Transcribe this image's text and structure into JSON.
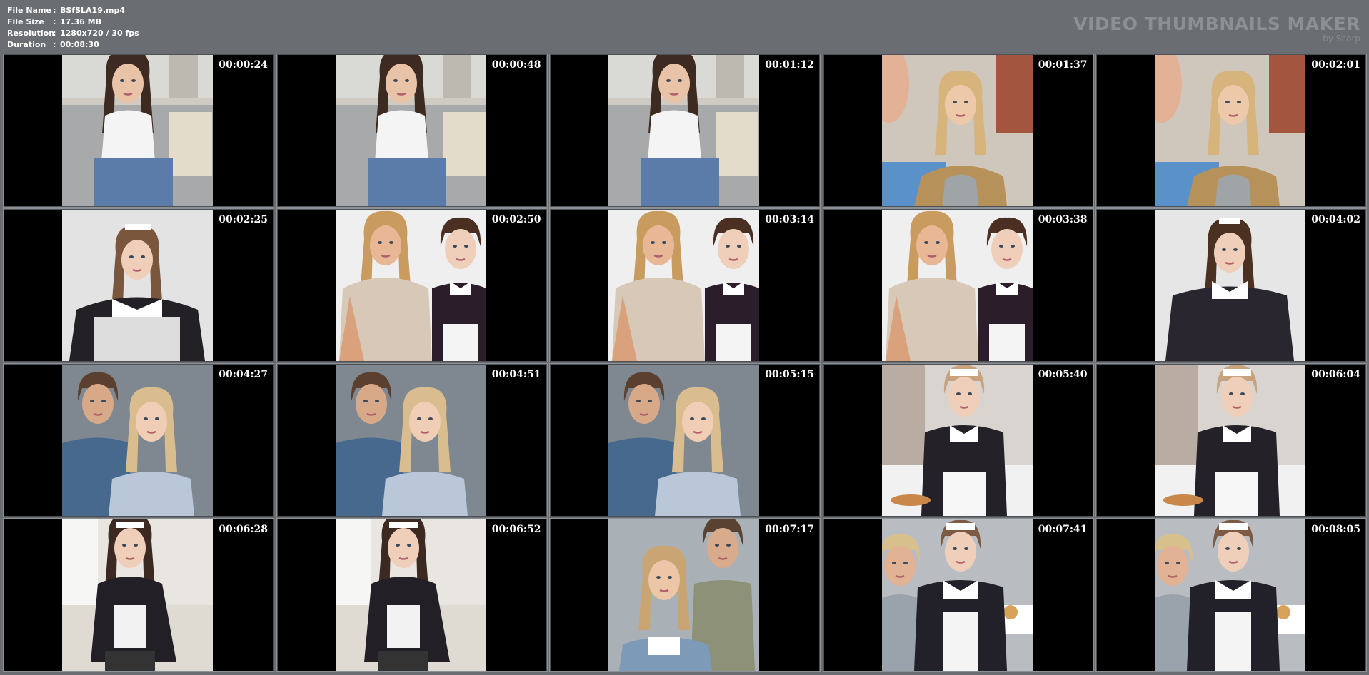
{
  "header": {
    "file_name_label": "File Name",
    "file_name": "BSfSLA19.mp4",
    "file_size_label": "File Size",
    "file_size": "17.36 MB",
    "resolution_label": "Resolution",
    "resolution": "1280x720 / 30 fps",
    "duration_label": "Duration",
    "duration": "00:08:30",
    "separator": ":"
  },
  "brand": {
    "title": "VIDEO THUMBNAILS MAKER",
    "subtitle": "by Scorp"
  },
  "colors": {
    "background": "#6a6e73",
    "tile_background": "#000000",
    "brand_text": "#8b9095",
    "text": "#ffffff"
  },
  "thumbnails": [
    {
      "time": "00:00:24",
      "scene": "sofa"
    },
    {
      "time": "00:00:48",
      "scene": "sofa"
    },
    {
      "time": "00:01:12",
      "scene": "sofa"
    },
    {
      "time": "00:01:37",
      "scene": "blonde-angry"
    },
    {
      "time": "00:02:01",
      "scene": "blonde-angry"
    },
    {
      "time": "00:02:25",
      "scene": "maid-portrait"
    },
    {
      "time": "00:02:50",
      "scene": "blonde-and-maid"
    },
    {
      "time": "00:03:14",
      "scene": "blonde-and-maid"
    },
    {
      "time": "00:03:38",
      "scene": "blonde-and-maid"
    },
    {
      "time": "00:04:02",
      "scene": "maid-portrait-dark-hair"
    },
    {
      "time": "00:04:27",
      "scene": "couple"
    },
    {
      "time": "00:04:51",
      "scene": "couple"
    },
    {
      "time": "00:05:15",
      "scene": "couple"
    },
    {
      "time": "00:05:40",
      "scene": "maid-tray"
    },
    {
      "time": "00:06:04",
      "scene": "maid-tray"
    },
    {
      "time": "00:06:28",
      "scene": "maid-sitting"
    },
    {
      "time": "00:06:52",
      "scene": "maid-sitting"
    },
    {
      "time": "00:07:17",
      "scene": "blonde-closeup"
    },
    {
      "time": "00:07:41",
      "scene": "maid-bedroom"
    },
    {
      "time": "00:08:05",
      "scene": "maid-bedroom"
    }
  ]
}
